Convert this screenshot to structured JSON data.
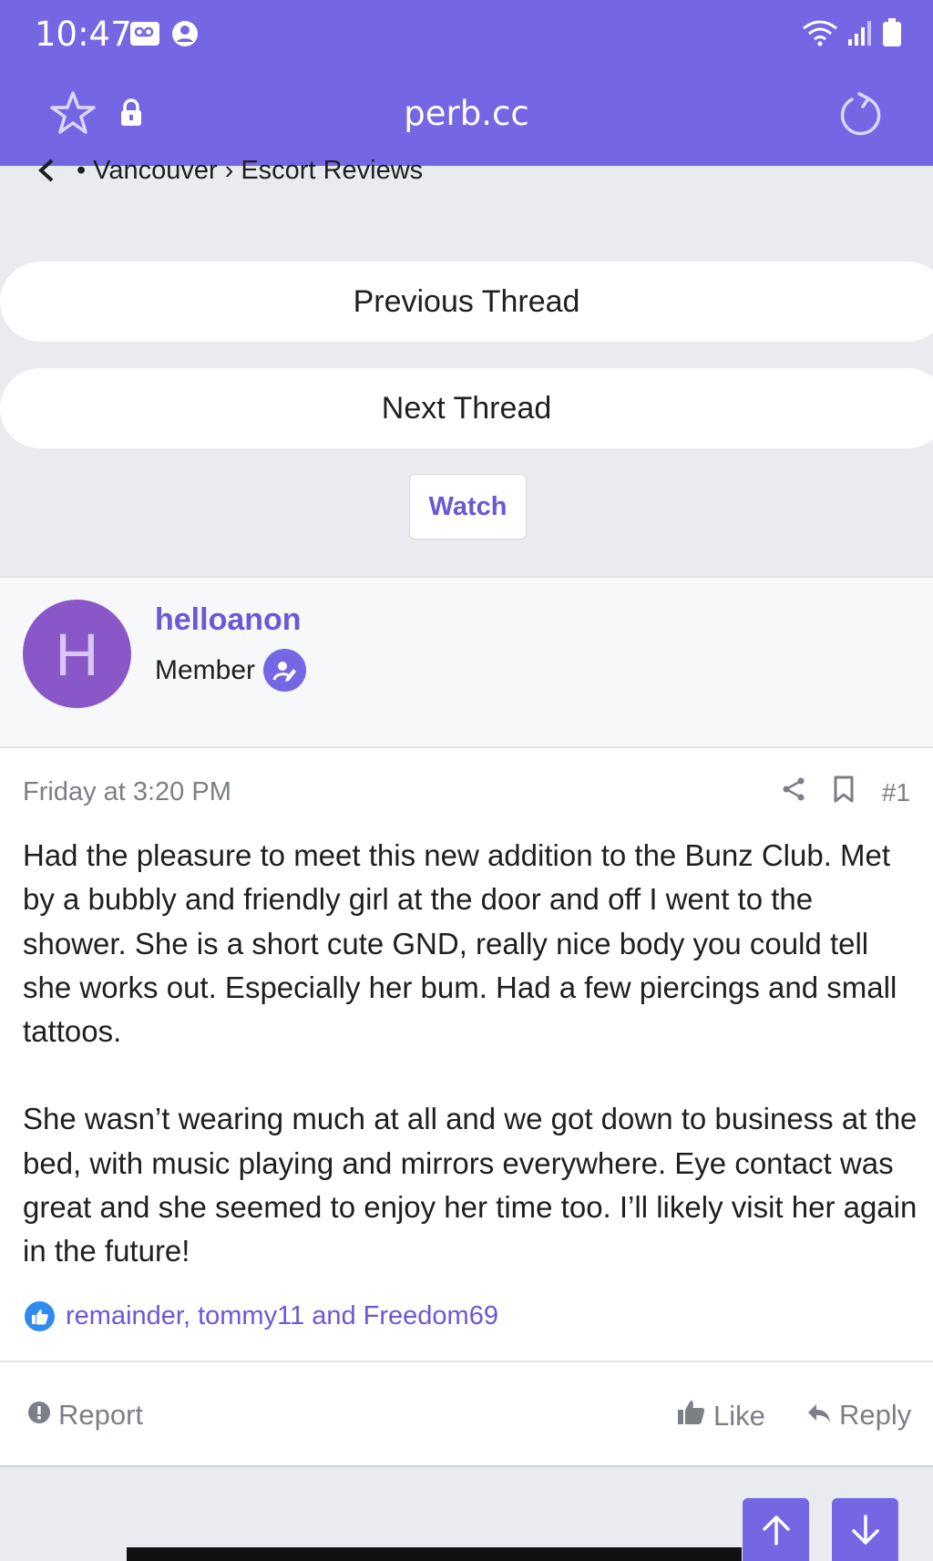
{
  "status_bar": {
    "time": "10:47"
  },
  "address_bar": {
    "url": "perb.cc"
  },
  "breadcrumb": {
    "bullet": "•",
    "items": [
      "Vancouver",
      "Escort Reviews"
    ],
    "separator": "›"
  },
  "thread_nav": {
    "previous_label": "Previous Thread",
    "next_label": "Next Thread",
    "watch_label": "Watch"
  },
  "post": {
    "avatar_letter": "H",
    "username": "helloanon",
    "user_title": "Member",
    "date": "Friday at 3:20 PM",
    "number": "#1",
    "paragraphs": [
      "Had the pleasure to meet this new addition to the Bunz Club. Met by a bubbly and friendly girl at the door and off I went to the shower. She is a short cute GND, really nice body you could tell she works out. Especially her bum. Had a few piercings and small tattoos.",
      "She wasn’t wearing much at all and we got down to business at the bed, with music playing and mirrors everywhere. Eye contact was great and she seemed to enjoy her time too. I’ll likely visit her again in the future!"
    ],
    "reactions_text": "remainder, tommy11 and Freedom69",
    "footer": {
      "report_label": "Report",
      "like_label": "Like",
      "reply_label": "Reply"
    }
  },
  "colors": {
    "accent": "#7566e3",
    "link": "#6a58d6",
    "avatar_bg": "#8a57c9",
    "reaction_blue": "#2f8cef"
  }
}
